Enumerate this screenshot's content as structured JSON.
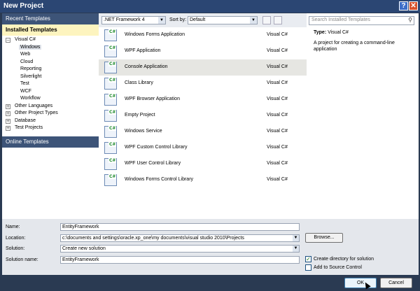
{
  "window": {
    "title": "New Project",
    "help_label": "?",
    "close_label": "✕"
  },
  "left": {
    "recent": "Recent Templates",
    "installed": "Installed Templates",
    "online": "Online Templates",
    "tree": [
      {
        "label": "Visual C#",
        "indent": 0,
        "expander": "−"
      },
      {
        "label": "Windows",
        "indent": 1,
        "expander": "",
        "selected": true
      },
      {
        "label": "Web",
        "indent": 1,
        "expander": ""
      },
      {
        "label": "Cloud",
        "indent": 1,
        "expander": ""
      },
      {
        "label": "Reporting",
        "indent": 1,
        "expander": ""
      },
      {
        "label": "Silverlight",
        "indent": 1,
        "expander": ""
      },
      {
        "label": "Test",
        "indent": 1,
        "expander": ""
      },
      {
        "label": "WCF",
        "indent": 1,
        "expander": ""
      },
      {
        "label": "Workflow",
        "indent": 1,
        "expander": ""
      },
      {
        "label": "Other Languages",
        "indent": 0,
        "expander": "+"
      },
      {
        "label": "Other Project Types",
        "indent": 0,
        "expander": "+"
      },
      {
        "label": "Database",
        "indent": 0,
        "expander": "+"
      },
      {
        "label": "Test Projects",
        "indent": 0,
        "expander": "+"
      }
    ]
  },
  "toolbar": {
    "framework": ".NET Framework 4",
    "sort_label": "Sort by:",
    "sort_value": "Default"
  },
  "templates": [
    {
      "name": "Windows Forms Application",
      "lang": "Visual C#"
    },
    {
      "name": "WPF Application",
      "lang": "Visual C#"
    },
    {
      "name": "Console Application",
      "lang": "Visual C#",
      "selected": true
    },
    {
      "name": "Class Library",
      "lang": "Visual C#"
    },
    {
      "name": "WPF Browser Application",
      "lang": "Visual C#"
    },
    {
      "name": "Empty Project",
      "lang": "Visual C#"
    },
    {
      "name": "Windows Service",
      "lang": "Visual C#"
    },
    {
      "name": "WPF Custom Control Library",
      "lang": "Visual C#"
    },
    {
      "name": "WPF User Control Library",
      "lang": "Visual C#"
    },
    {
      "name": "Windows Forms Control Library",
      "lang": "Visual C#"
    }
  ],
  "right": {
    "search_placeholder": "Search Installed Templates",
    "type_label": "Type:",
    "type_value": "Visual C#",
    "description": "A project for creating a command-line application"
  },
  "form": {
    "name_label": "Name:",
    "name_value": "EntityFramework",
    "location_label": "Location:",
    "location_value": "c:\\documents and settings\\oracle.xp_one\\my documents\\visual studio 2010\\Projects",
    "solution_label": "Solution:",
    "solution_value": "Create new solution",
    "solution_name_label": "Solution name:",
    "solution_name_value": "EntityFramework",
    "browse_label": "Browse...",
    "create_dir_label": "Create directory for solution",
    "create_dir_checked": "✓",
    "source_control_label": "Add to Source Control"
  },
  "buttons": {
    "ok": "OK",
    "cancel": "Cancel"
  }
}
